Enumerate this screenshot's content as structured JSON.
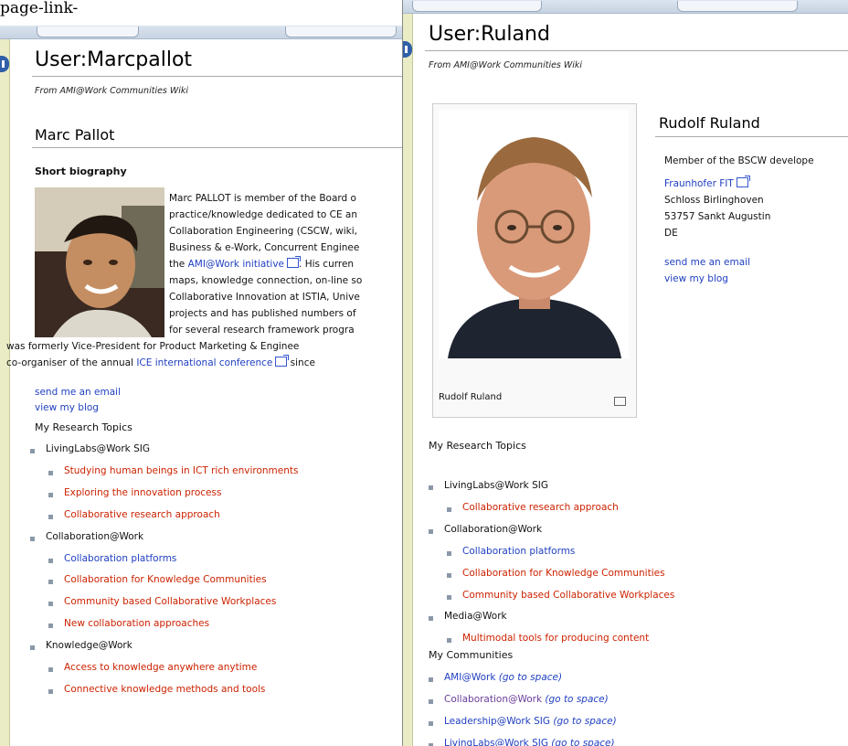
{
  "caption": "page-link-",
  "left": {
    "title": "User:Marcpallot",
    "from": "From AMI@Work Communities Wiki",
    "name": "Marc Pallot",
    "short_bio_heading": "Short biography",
    "bio_lines": [
      "Marc PALLOT is member of the Board o",
      "practice/knowledge dedicated to CE an",
      "Collaboration Engineering (CSCW, wiki,",
      "Business & e-Work, Concurrent Enginee",
      "the ",
      ". His curren",
      "maps, knowledge connection, on-line so",
      "Collaborative Innovation at ISTIA, Unive",
      "projects and has published numbers of",
      "for several research framework progra",
      "was formerly Vice-President for Product Marketing & Enginee",
      "co-organiser of the annual ",
      " since"
    ],
    "ami_link": "AMI@Work initiative",
    "ice_link": "ICE international conference",
    "send_email": "send me an email",
    "view_blog": "view my blog",
    "topics_heading": "My Research Topics",
    "topics": [
      {
        "label": "LivingLabs@Work SIG",
        "level": 0,
        "color": "black"
      },
      {
        "label": "Studying human beings in ICT rich environments",
        "level": 1,
        "color": "red"
      },
      {
        "label": "Exploring the innovation process",
        "level": 1,
        "color": "red"
      },
      {
        "label": "Collaborative research approach",
        "level": 1,
        "color": "red"
      },
      {
        "label": "Collaboration@Work",
        "level": 0,
        "color": "black"
      },
      {
        "label": "Collaboration platforms",
        "level": 1,
        "color": "blue"
      },
      {
        "label": "Collaboration for Knowledge Communities",
        "level": 1,
        "color": "red"
      },
      {
        "label": "Community based Collaborative Workplaces",
        "level": 1,
        "color": "red"
      },
      {
        "label": "New collaboration approaches",
        "level": 1,
        "color": "red"
      },
      {
        "label": "Knowledge@Work",
        "level": 0,
        "color": "black"
      },
      {
        "label": "Access to knowledge anywhere anytime",
        "level": 1,
        "color": "red"
      },
      {
        "label": "Connective knowledge methods and tools",
        "level": 1,
        "color": "red"
      }
    ]
  },
  "right": {
    "title": "User:Ruland",
    "from": "From AMI@Work Communities Wiki",
    "photo_caption": "Rudolf Ruland",
    "name": "Rudolf Ruland",
    "member_line": "Member of the BSCW develope",
    "org_link": "Fraunhofer FIT",
    "address": [
      "Schloss Birlinghoven",
      "53757 Sankt Augustin",
      "DE"
    ],
    "send_email": "send me an email",
    "view_blog": "view my blog",
    "topics_heading": "My Research Topics",
    "topics": [
      {
        "label": "LivingLabs@Work SIG",
        "level": 0,
        "color": "black"
      },
      {
        "label": "Collaborative research approach",
        "level": 1,
        "color": "red"
      },
      {
        "label": "Collaboration@Work",
        "level": 0,
        "color": "black"
      },
      {
        "label": "Collaboration platforms",
        "level": 1,
        "color": "blue"
      },
      {
        "label": "Collaboration for Knowledge Communities",
        "level": 1,
        "color": "red"
      },
      {
        "label": "Community based Collaborative Workplaces",
        "level": 1,
        "color": "red"
      },
      {
        "label": "Media@Work",
        "level": 0,
        "color": "black"
      },
      {
        "label": "Multimodal tools for producing content",
        "level": 1,
        "color": "red"
      }
    ],
    "communities_heading": "My Communities",
    "communities": [
      {
        "label": "AMI@Work",
        "suffix": "(go to space)",
        "color": "blue"
      },
      {
        "label": "Collaboration@Work",
        "suffix": "(go to space)",
        "color": "purple"
      },
      {
        "label": "Leadership@Work SIG",
        "suffix": "(go to space)",
        "color": "blue"
      },
      {
        "label": "LivingLabs@Work SIG",
        "suffix": "(go to space)",
        "color": "blue"
      }
    ]
  }
}
